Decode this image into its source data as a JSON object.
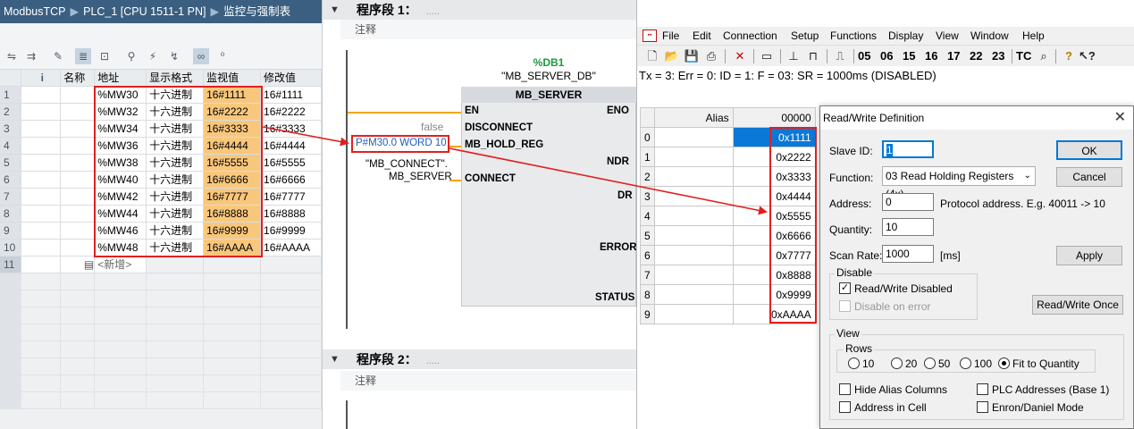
{
  "left": {
    "breadcrumb": [
      "ModbusTCP",
      "PLC_1 [CPU 1511-1 PN]",
      "监控与强制表"
    ],
    "columns": [
      "名称",
      "地址",
      "显示格式",
      "监视值",
      "修改值"
    ],
    "info_icon": "i",
    "rows": [
      {
        "n": "1",
        "addr": "%MW30",
        "fmt": "十六进制",
        "mon": "16#1111",
        "mod": "16#1111"
      },
      {
        "n": "2",
        "addr": "%MW32",
        "fmt": "十六进制",
        "mon": "16#2222",
        "mod": "16#2222"
      },
      {
        "n": "3",
        "addr": "%MW34",
        "fmt": "十六进制",
        "mon": "16#3333",
        "mod": "16#3333"
      },
      {
        "n": "4",
        "addr": "%MW36",
        "fmt": "十六进制",
        "mon": "16#4444",
        "mod": "16#4444"
      },
      {
        "n": "5",
        "addr": "%MW38",
        "fmt": "十六进制",
        "mon": "16#5555",
        "mod": "16#5555"
      },
      {
        "n": "6",
        "addr": "%MW40",
        "fmt": "十六进制",
        "mon": "16#6666",
        "mod": "16#6666"
      },
      {
        "n": "7",
        "addr": "%MW42",
        "fmt": "十六进制",
        "mon": "16#7777",
        "mod": "16#7777"
      },
      {
        "n": "8",
        "addr": "%MW44",
        "fmt": "十六进制",
        "mon": "16#8888",
        "mod": "16#8888"
      },
      {
        "n": "9",
        "addr": "%MW46",
        "fmt": "十六进制",
        "mon": "16#9999",
        "mod": "16#9999"
      },
      {
        "n": "10",
        "addr": "%MW48",
        "fmt": "十六进制",
        "mon": "16#AAAA",
        "mod": "16#AAAA"
      }
    ],
    "new_row": {
      "n": "11",
      "label": "<新增>"
    }
  },
  "mid": {
    "seg1": "程序段 1：",
    "seg2": "程序段 2：",
    "dots": ".....",
    "comment": "注释",
    "db_name": "%DB1",
    "db_symbol": "\"MB_SERVER_DB\"",
    "block_name": "MB_SERVER",
    "pins_left": [
      "EN",
      "DISCONNECT",
      "MB_HOLD_REG",
      "CONNECT"
    ],
    "pins_right": [
      "ENO",
      "NDR",
      "DR",
      "ERROR",
      "STATUS"
    ],
    "false_label": "false",
    "hold_reg_param": "P#M30.0 WORD 10",
    "connect_param_1": "\"MB_CONNECT\".",
    "connect_param_2": "MB_SERVER"
  },
  "right": {
    "menu": [
      "File",
      "Edit",
      "Connection",
      "Setup",
      "Functions",
      "Display",
      "View",
      "Window",
      "Help"
    ],
    "toolbar_fn": [
      "05",
      "06",
      "15",
      "16",
      "17",
      "22",
      "23",
      "TC"
    ],
    "status": "Tx = 3: Err = 0: ID = 1: F = 03: SR = 1000ms  (DISABLED)",
    "grid": {
      "alias_header": "Alias",
      "value_header": "00000",
      "rows": [
        {
          "i": "0",
          "v": "0x1111"
        },
        {
          "i": "1",
          "v": "0x2222"
        },
        {
          "i": "2",
          "v": "0x3333"
        },
        {
          "i": "3",
          "v": "0x4444"
        },
        {
          "i": "4",
          "v": "0x5555"
        },
        {
          "i": "5",
          "v": "0x6666"
        },
        {
          "i": "6",
          "v": "0x7777"
        },
        {
          "i": "7",
          "v": "0x8888"
        },
        {
          "i": "8",
          "v": "0x9999"
        },
        {
          "i": "9",
          "v": "0xAAAA"
        }
      ]
    },
    "dialog": {
      "title": "Read/Write Definition",
      "slave_id_label": "Slave ID:",
      "slave_id": "1",
      "function_label": "Function:",
      "function": "03 Read Holding Registers (4x)",
      "address_label": "Address:",
      "address": "0",
      "address_hint": "Protocol address. E.g. 40011 -> 10",
      "quantity_label": "Quantity:",
      "quantity": "10",
      "scan_rate_label": "Scan Rate:",
      "scan_rate": "1000",
      "scan_unit": "[ms]",
      "ok": "OK",
      "cancel": "Cancel",
      "apply": "Apply",
      "disable_group": "Disable",
      "rw_disabled": "Read/Write Disabled",
      "disable_on_error": "Disable on error",
      "rw_once": "Read/Write Once",
      "view_group": "View",
      "rows_group": "Rows",
      "rows_options": [
        "10",
        "20",
        "50",
        "100",
        "Fit to Quantity"
      ],
      "hide_alias": "Hide Alias Columns",
      "plc_addresses": "PLC Addresses (Base 1)",
      "address_in_cell": "Address in Cell",
      "enron": "Enron/Daniel Mode"
    }
  },
  "colors": {
    "highlight_box": "#e02020",
    "monitor_cell": "#f9c77c",
    "selected_cell": "#0a78d7",
    "wire": "#f0a500"
  }
}
